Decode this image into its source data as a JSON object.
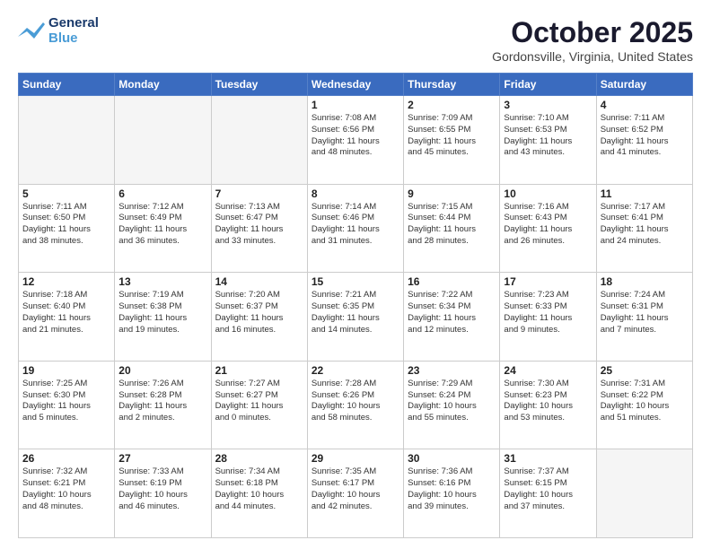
{
  "logo": {
    "line1": "General",
    "line2": "Blue"
  },
  "title": "October 2025",
  "location": "Gordonsville, Virginia, United States",
  "weekdays": [
    "Sunday",
    "Monday",
    "Tuesday",
    "Wednesday",
    "Thursday",
    "Friday",
    "Saturday"
  ],
  "weeks": [
    [
      {
        "day": "",
        "info": ""
      },
      {
        "day": "",
        "info": ""
      },
      {
        "day": "",
        "info": ""
      },
      {
        "day": "1",
        "info": "Sunrise: 7:08 AM\nSunset: 6:56 PM\nDaylight: 11 hours\nand 48 minutes."
      },
      {
        "day": "2",
        "info": "Sunrise: 7:09 AM\nSunset: 6:55 PM\nDaylight: 11 hours\nand 45 minutes."
      },
      {
        "day": "3",
        "info": "Sunrise: 7:10 AM\nSunset: 6:53 PM\nDaylight: 11 hours\nand 43 minutes."
      },
      {
        "day": "4",
        "info": "Sunrise: 7:11 AM\nSunset: 6:52 PM\nDaylight: 11 hours\nand 41 minutes."
      }
    ],
    [
      {
        "day": "5",
        "info": "Sunrise: 7:11 AM\nSunset: 6:50 PM\nDaylight: 11 hours\nand 38 minutes."
      },
      {
        "day": "6",
        "info": "Sunrise: 7:12 AM\nSunset: 6:49 PM\nDaylight: 11 hours\nand 36 minutes."
      },
      {
        "day": "7",
        "info": "Sunrise: 7:13 AM\nSunset: 6:47 PM\nDaylight: 11 hours\nand 33 minutes."
      },
      {
        "day": "8",
        "info": "Sunrise: 7:14 AM\nSunset: 6:46 PM\nDaylight: 11 hours\nand 31 minutes."
      },
      {
        "day": "9",
        "info": "Sunrise: 7:15 AM\nSunset: 6:44 PM\nDaylight: 11 hours\nand 28 minutes."
      },
      {
        "day": "10",
        "info": "Sunrise: 7:16 AM\nSunset: 6:43 PM\nDaylight: 11 hours\nand 26 minutes."
      },
      {
        "day": "11",
        "info": "Sunrise: 7:17 AM\nSunset: 6:41 PM\nDaylight: 11 hours\nand 24 minutes."
      }
    ],
    [
      {
        "day": "12",
        "info": "Sunrise: 7:18 AM\nSunset: 6:40 PM\nDaylight: 11 hours\nand 21 minutes."
      },
      {
        "day": "13",
        "info": "Sunrise: 7:19 AM\nSunset: 6:38 PM\nDaylight: 11 hours\nand 19 minutes."
      },
      {
        "day": "14",
        "info": "Sunrise: 7:20 AM\nSunset: 6:37 PM\nDaylight: 11 hours\nand 16 minutes."
      },
      {
        "day": "15",
        "info": "Sunrise: 7:21 AM\nSunset: 6:35 PM\nDaylight: 11 hours\nand 14 minutes."
      },
      {
        "day": "16",
        "info": "Sunrise: 7:22 AM\nSunset: 6:34 PM\nDaylight: 11 hours\nand 12 minutes."
      },
      {
        "day": "17",
        "info": "Sunrise: 7:23 AM\nSunset: 6:33 PM\nDaylight: 11 hours\nand 9 minutes."
      },
      {
        "day": "18",
        "info": "Sunrise: 7:24 AM\nSunset: 6:31 PM\nDaylight: 11 hours\nand 7 minutes."
      }
    ],
    [
      {
        "day": "19",
        "info": "Sunrise: 7:25 AM\nSunset: 6:30 PM\nDaylight: 11 hours\nand 5 minutes."
      },
      {
        "day": "20",
        "info": "Sunrise: 7:26 AM\nSunset: 6:28 PM\nDaylight: 11 hours\nand 2 minutes."
      },
      {
        "day": "21",
        "info": "Sunrise: 7:27 AM\nSunset: 6:27 PM\nDaylight: 11 hours\nand 0 minutes."
      },
      {
        "day": "22",
        "info": "Sunrise: 7:28 AM\nSunset: 6:26 PM\nDaylight: 10 hours\nand 58 minutes."
      },
      {
        "day": "23",
        "info": "Sunrise: 7:29 AM\nSunset: 6:24 PM\nDaylight: 10 hours\nand 55 minutes."
      },
      {
        "day": "24",
        "info": "Sunrise: 7:30 AM\nSunset: 6:23 PM\nDaylight: 10 hours\nand 53 minutes."
      },
      {
        "day": "25",
        "info": "Sunrise: 7:31 AM\nSunset: 6:22 PM\nDaylight: 10 hours\nand 51 minutes."
      }
    ],
    [
      {
        "day": "26",
        "info": "Sunrise: 7:32 AM\nSunset: 6:21 PM\nDaylight: 10 hours\nand 48 minutes."
      },
      {
        "day": "27",
        "info": "Sunrise: 7:33 AM\nSunset: 6:19 PM\nDaylight: 10 hours\nand 46 minutes."
      },
      {
        "day": "28",
        "info": "Sunrise: 7:34 AM\nSunset: 6:18 PM\nDaylight: 10 hours\nand 44 minutes."
      },
      {
        "day": "29",
        "info": "Sunrise: 7:35 AM\nSunset: 6:17 PM\nDaylight: 10 hours\nand 42 minutes."
      },
      {
        "day": "30",
        "info": "Sunrise: 7:36 AM\nSunset: 6:16 PM\nDaylight: 10 hours\nand 39 minutes."
      },
      {
        "day": "31",
        "info": "Sunrise: 7:37 AM\nSunset: 6:15 PM\nDaylight: 10 hours\nand 37 minutes."
      },
      {
        "day": "",
        "info": ""
      }
    ]
  ]
}
